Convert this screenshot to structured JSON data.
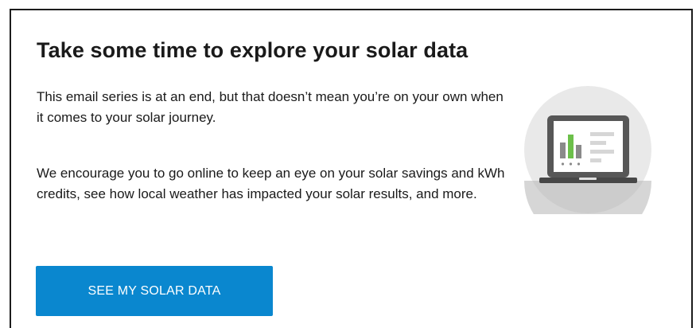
{
  "email": {
    "title": "Take some time to explore your solar data",
    "paragraph_1": "This email series is at an end, but that doesn’t mean you’re on your own when it comes to your solar journey.",
    "paragraph_2": "We encourage you to go online to keep an eye on your solar savings and kWh credits, see how local weather has impacted your solar results, and more.",
    "cta_label": "SEE MY SOLAR DATA"
  },
  "illustration": {
    "icon": "laptop-chart-icon"
  },
  "colors": {
    "accent": "#0a87cf",
    "circle": "#e9e9e9",
    "bar_green": "#6cc04a",
    "bar_gray": "#8a8a8a",
    "laptop": "#575757"
  }
}
